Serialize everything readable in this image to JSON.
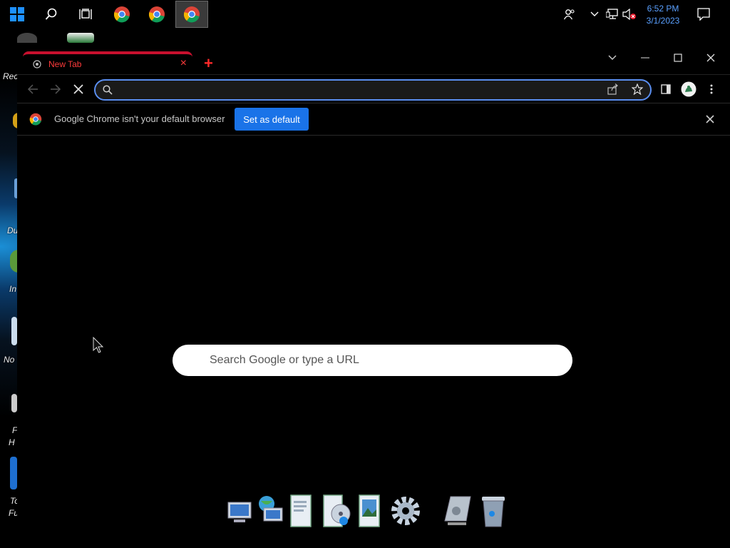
{
  "taskbar": {
    "clock_time": "6:52 PM",
    "clock_date": "3/1/2023",
    "icons": [
      "windows-start-icon",
      "search-icon",
      "task-view-icon",
      "chrome-icon",
      "chrome-icon",
      "chrome-icon",
      "people-icon",
      "chevron-up-icon",
      "network-icon",
      "volume-muted-icon",
      "notification-icon"
    ]
  },
  "desktop": {
    "labels": [
      "Rec",
      "Du",
      "In",
      "No",
      "F",
      "H",
      "To",
      "Fu"
    ]
  },
  "browser": {
    "tab_title": "New Tab",
    "tab_close": "×",
    "newtab_symbol": "+",
    "omnibox_value": "",
    "omnibox_placeholder": "",
    "infobar_text": "Google Chrome isn't your default browser",
    "set_default_label": "Set as default",
    "ntp_search_placeholder": "Search Google or type a URL"
  },
  "colors": {
    "accent_red": "#c8102e",
    "button_blue": "#1a73e8",
    "omnibox_focus": "#5a8ef0",
    "clock_blue": "#5aa0ff"
  }
}
